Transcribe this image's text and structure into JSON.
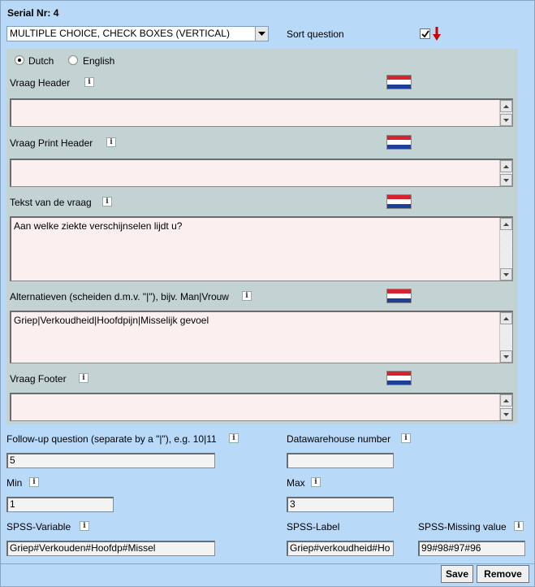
{
  "serial": {
    "label": "Serial Nr:",
    "value": "4"
  },
  "question_type": {
    "selected": "MULTIPLE CHOICE, CHECK BOXES (VERTICAL)"
  },
  "sort_question": {
    "label": "Sort question",
    "checked": true
  },
  "languages": [
    {
      "label": "Dutch",
      "selected": true
    },
    {
      "label": "English",
      "selected": false
    }
  ],
  "fields": {
    "vraag_header": {
      "label": "Vraag Header",
      "value": ""
    },
    "vraag_print_header": {
      "label": "Vraag Print Header",
      "value": ""
    },
    "tekst_van_de_vraag": {
      "label": "Tekst van de vraag",
      "value": "Aan welke ziekte verschijnselen lijdt u?"
    },
    "alternatieven": {
      "label": "Alternatieven (scheiden d.m.v. \"|\"), bijv. Man|Vrouw",
      "value": "Griep|Verkoudheid|Hoofdpijn|Misselijk gevoel"
    },
    "vraag_footer": {
      "label": "Vraag Footer",
      "value": ""
    }
  },
  "follow_up": {
    "label": "Follow-up question (separate by a \"|\"), e.g. 10|11",
    "value": "5"
  },
  "datawarehouse": {
    "label": "Datawarehouse number",
    "value": ""
  },
  "min": {
    "label": "Min",
    "value": "1"
  },
  "max": {
    "label": "Max",
    "value": "3"
  },
  "spss_variable": {
    "label": "SPSS-Variable",
    "value": "Griep#Verkouden#Hoofdp#Missel"
  },
  "spss_label": {
    "label": "SPSS-Label",
    "value": "Griep#verkoudheid#Ho"
  },
  "spss_missing": {
    "label": "SPSS-Missing value",
    "value": "99#98#97#96"
  },
  "buttons": {
    "save": "Save",
    "remove": "Remove"
  },
  "colors": {
    "panel": "#b9d9f8",
    "section": "#c3d2d3",
    "textarea": "#fbf0ef",
    "arrow": "#cc0000"
  },
  "icons": {
    "info": "info-icon",
    "flag": "dutch-flag-icon",
    "sort": "red-down-arrow-icon"
  }
}
